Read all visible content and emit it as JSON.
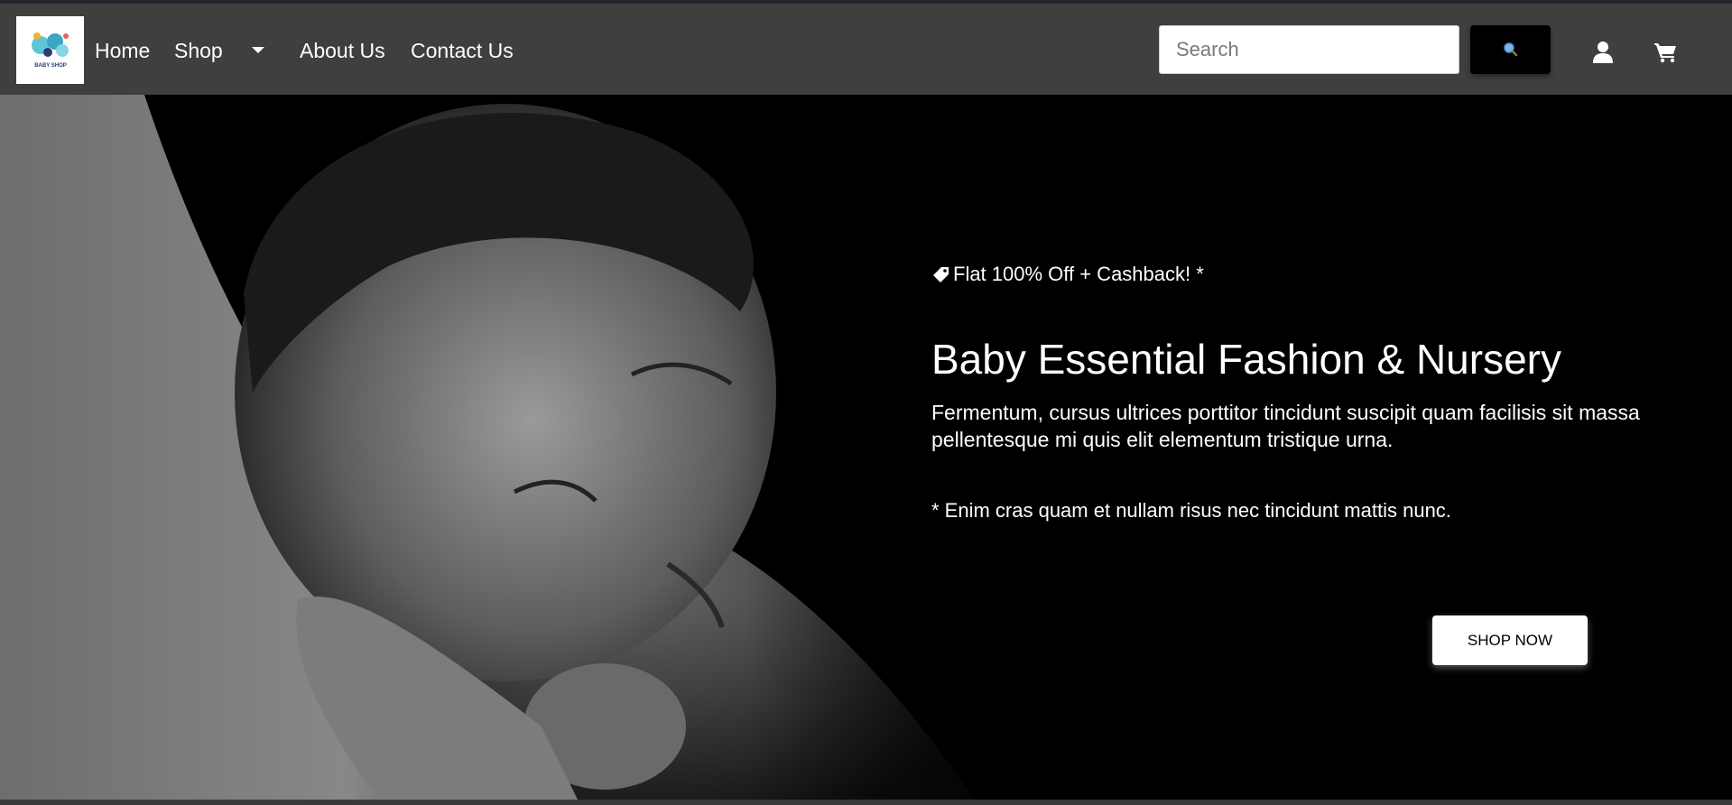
{
  "header": {
    "logo_text": "BABY SHOP",
    "nav": {
      "home": "Home",
      "shop": "Shop",
      "about": "About Us",
      "contact": "Contact Us"
    },
    "search": {
      "placeholder": "Search",
      "value": ""
    },
    "icons": {
      "search_button": "search-icon",
      "user": "user-icon",
      "cart": "cart-icon",
      "shop_dropdown": "caret-down-icon"
    }
  },
  "hero": {
    "promo": "Flat 100% Off + Cashback! *",
    "promo_icon": "tag-icon",
    "title": "Baby Essential Fashion & Nursery",
    "description": "Fermentum, cursus ultrices porttitor tincidunt suscipit quam facilisis sit massa pellentesque mi quis elit elementum tristique urna.",
    "note": "* Enim cras quam et nullam risus nec tincidunt mattis nunc.",
    "cta_label": "SHOP NOW"
  },
  "colors": {
    "navbar_bg": "#3f3f3f",
    "hero_bg": "#000000",
    "search_button_bg": "#000000",
    "cta_bg": "#ffffff",
    "text": "#ffffff"
  }
}
